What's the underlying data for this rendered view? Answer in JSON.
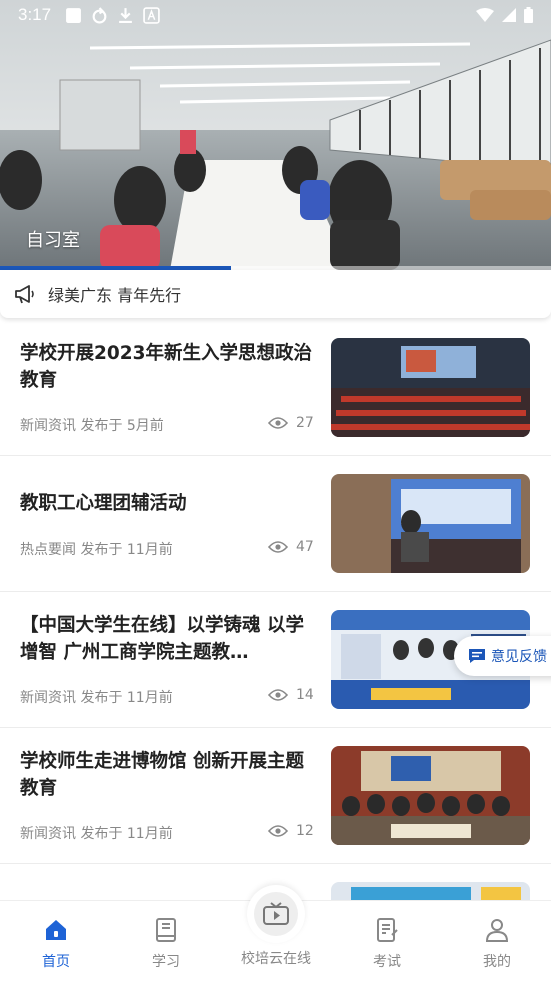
{
  "status_bar": {
    "time": "3:17",
    "icons": [
      "app-square-icon",
      "sync-icon",
      "download-icon",
      "a-box-icon",
      "wifi-icon",
      "signal-icon",
      "battery-icon"
    ]
  },
  "banner": {
    "caption": "自习室",
    "progress": 0.42
  },
  "notice": {
    "icon": "megaphone-icon",
    "text": "绿美广东 青年先行"
  },
  "feed": [
    {
      "title": "学校开展2023年新生入学思想政治教育",
      "category": "新闻资讯",
      "published": "发布于 5月前",
      "views": "27"
    },
    {
      "title": "教职工心理团辅活动",
      "category": "热点要闻",
      "published": "发布于 11月前",
      "views": "47"
    },
    {
      "title": "【中国大学生在线】以学铸魂 以学增智 广州工商学院主题教…",
      "category": "新闻资讯",
      "published": "发布于 11月前",
      "views": "14"
    },
    {
      "title": "学校师生走进博物馆 创新开展主题教育",
      "category": "新闻资讯",
      "published": "发布于 11月前",
      "views": "12"
    },
    {
      "title": "",
      "category": "",
      "published": "",
      "views": ""
    }
  ],
  "feedback": {
    "label": "意见反馈"
  },
  "tabbar": {
    "home": "首页",
    "study": "学习",
    "center": "校培云在线",
    "exam": "考试",
    "mine": "我的"
  },
  "colors": {
    "accent": "#1e63d6",
    "muted": "#888888"
  }
}
